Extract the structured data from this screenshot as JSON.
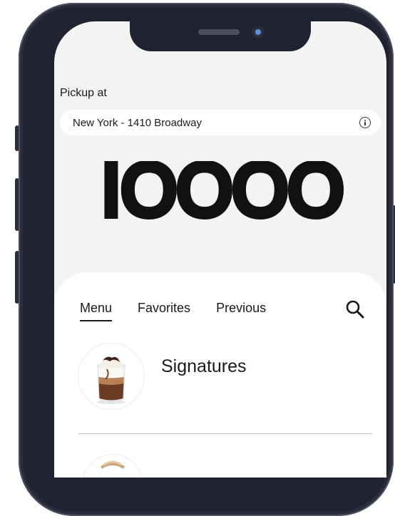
{
  "pickup": {
    "label": "Pickup at",
    "location": "New York - 1410 Broadway"
  },
  "brand": {
    "logo_text": "IOOOO"
  },
  "tabs": [
    {
      "label": "Menu",
      "active": true
    },
    {
      "label": "Favorites",
      "active": false
    },
    {
      "label": "Previous",
      "active": false
    }
  ],
  "categories": [
    {
      "label": "Signatures",
      "icon": "iced-coffee-drink-icon"
    }
  ],
  "colors": {
    "background": "#f3f3f1",
    "sheet": "#ffffff",
    "text": "#1a1a1a",
    "phone_frame": "#1f2230"
  }
}
